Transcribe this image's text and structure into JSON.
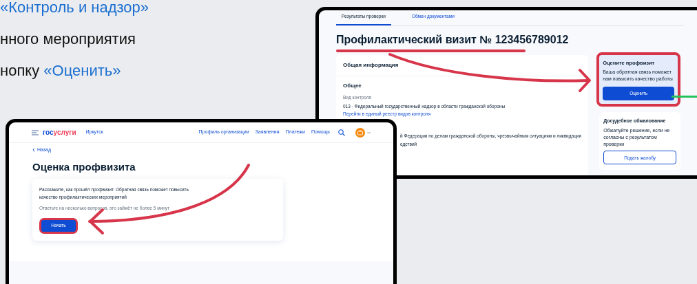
{
  "slide_text": [
    {
      "parts": [
        {
          "kind": "link",
          "text": "«Контроль и надзор»"
        }
      ]
    },
    {
      "parts": [
        {
          "kind": "plain",
          "text": "нного мероприятия"
        }
      ]
    },
    {
      "parts": [
        {
          "kind": "plain",
          "text": "нопку"
        },
        {
          "kind": "link",
          "text": "«Оценить»"
        }
      ]
    }
  ],
  "back_window": {
    "tabs": [
      {
        "label": "Результаты проверки",
        "selected": true
      },
      {
        "label": "Обмен документами",
        "selected": false
      }
    ],
    "title": "Профилактический визит № 123456789012",
    "info_card": {
      "heading": "Общая информация",
      "section": "Общее",
      "field_label": "Вид контроля",
      "field_value": "013 - Федеральный государственный надзор в области гражданской обороны",
      "link": "Перейти в единый реестр видов контроля",
      "partial_lines": [
        "й Федерации по делам гражданской обороны, чрезвычайным ситуациям и ликвидации",
        "едствий"
      ]
    },
    "rating_card": {
      "title": "Оцените профвизит",
      "text": "Ваша обратная связь поможет нам повысить качество работы",
      "button": "Оценить"
    },
    "appeal_card": {
      "title": "Досудебное обжалование",
      "text": "Обжалуйте решение, если не согласны с результатом проверки",
      "button": "Подать жалобу"
    }
  },
  "front_window": {
    "header": {
      "logo": [
        "гос",
        "услуги"
      ],
      "city": "Иркутск",
      "nav": [
        "Профиль организации",
        "Заявления",
        "Платежи",
        "Помощь"
      ]
    },
    "back_link": "Назад",
    "title": "Оценка профвизита",
    "card": {
      "text": "Расскажите, как прошёл профвизит. Обратная связь поможет повысить качество профилактических мероприятий",
      "hint": "Ответьте на несколько вопросов, это займёт не более 5 минут",
      "button": "Начать"
    }
  }
}
